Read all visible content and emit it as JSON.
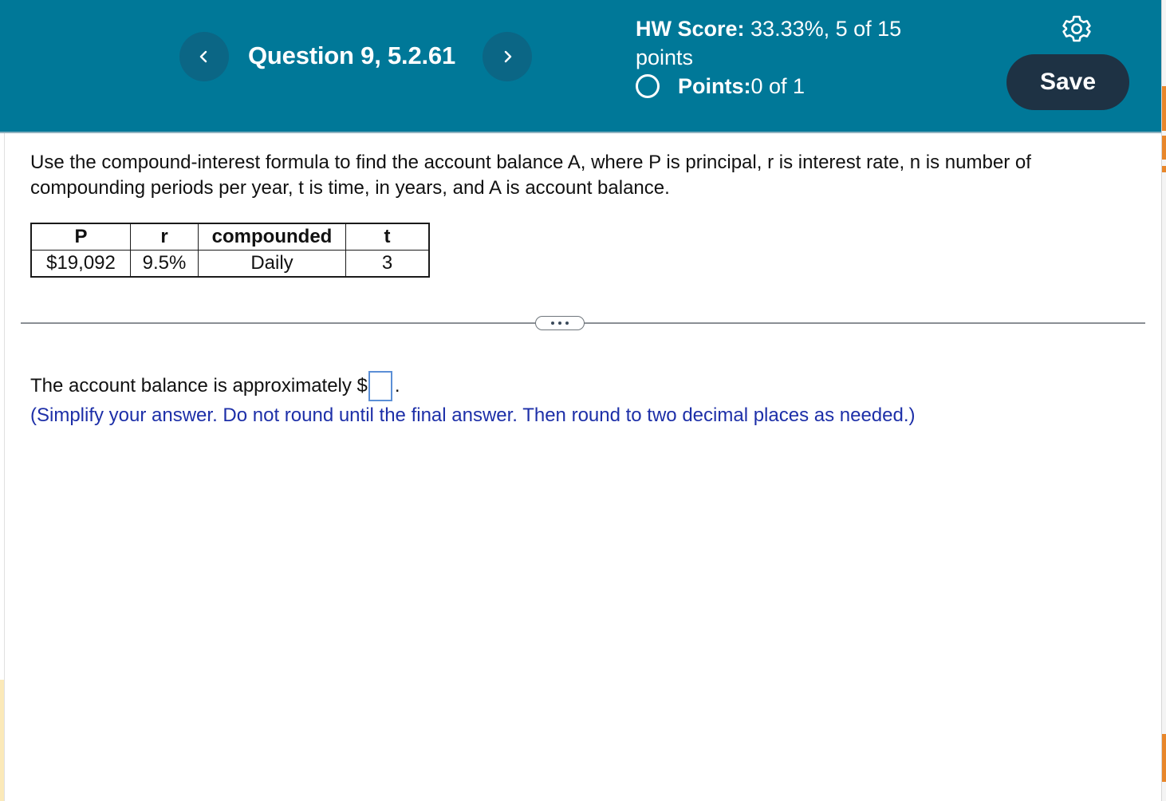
{
  "header": {
    "question_title": "Question 9, 5.2.61",
    "hw_score_label": "HW Score:",
    "hw_score_value": " 33.33%, 5 of 15",
    "hw_score_unit": "points",
    "points_label": "Points:",
    "points_value": " 0 of 1",
    "save_label": "Save",
    "prev_icon": "chevron-left-icon",
    "next_icon": "chevron-right-icon",
    "settings_icon": "gear-icon",
    "colors": {
      "header_bg": "#007898",
      "nav_button_bg": "#0b6685",
      "save_button_bg": "#1e3244"
    }
  },
  "question": {
    "instructions": "Use the compound-interest formula to find the account balance A, where P is principal, r is interest rate, n is number of compounding periods per year, t is time, in years, and A is account balance.",
    "table": {
      "headers": [
        "P",
        "r",
        "compounded",
        "t"
      ],
      "row": [
        "$19,092",
        "9.5%",
        "Daily",
        "3"
      ]
    },
    "more_icon": "ellipsis-icon",
    "answer_prefix": "The account balance is approximately $",
    "answer_value": "",
    "answer_suffix": ".",
    "hint": "(Simplify your answer. Do not round until the final answer. Then round to two decimal places as needed.)",
    "colors": {
      "hint_text": "#1d2fa8",
      "answer_box_border": "#5b8fd6"
    }
  }
}
